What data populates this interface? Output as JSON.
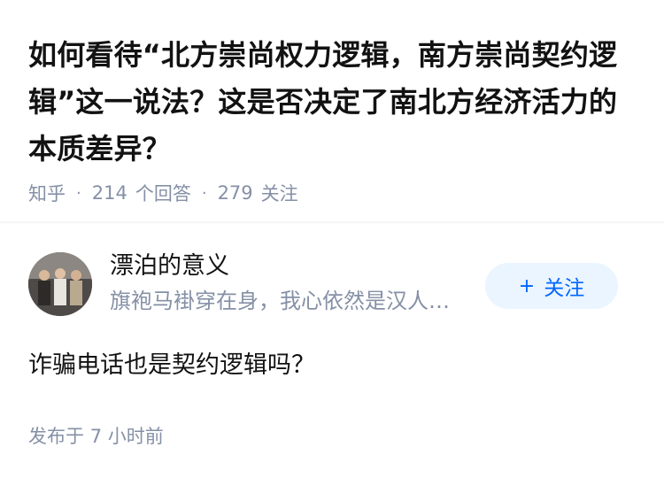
{
  "question": {
    "title": "如何看待“北方崇尚权力逻辑，南方崇尚契约逻辑”这一说法？这是否决定了南北方经济活力的本质差异？",
    "source": "知乎",
    "answers_count": "214",
    "answers_label": "个回答",
    "followers_count": "279",
    "followers_label": "关注"
  },
  "answer": {
    "author_name": "漂泊的意义",
    "author_bio": "旗袍马褂穿在身，我心依然是汉人…",
    "follow_plus": "+",
    "follow_label": "关注",
    "content": "诈骗电话也是契约逻辑吗？",
    "time_prefix": "发布于",
    "time_value": "7 小时前"
  },
  "colors": {
    "text": "#121212",
    "muted": "#8590a6",
    "brand_blue": "#0066ff",
    "follow_bg": "#ebf5ff",
    "divider": "#f4f5f7"
  },
  "icons": {
    "avatar": "group-photo-avatar",
    "meta_separator": "dot"
  }
}
